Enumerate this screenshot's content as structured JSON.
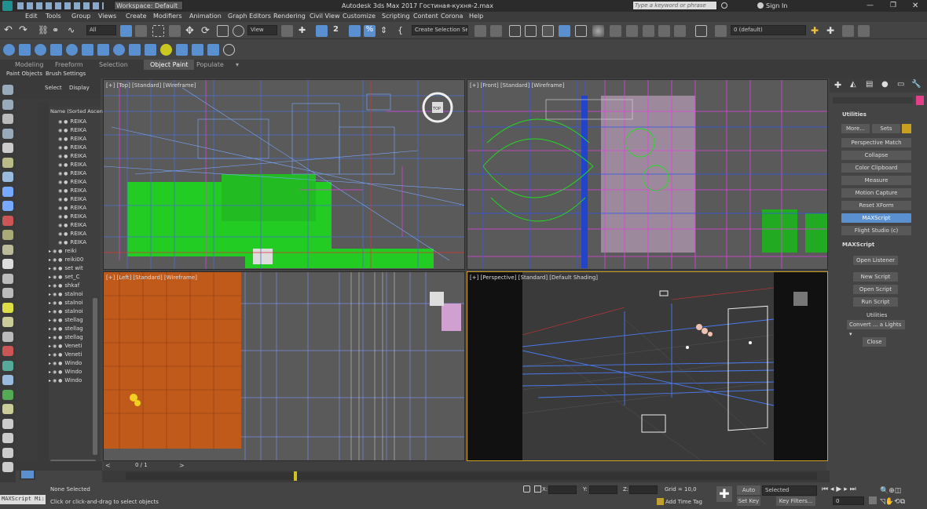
{
  "titlebar": {
    "workspace": "Workspace: Default",
    "title": "Autodesk 3ds Max 2017    Гостиная-кухня-2.max",
    "search_placeholder": "Type a keyword or phrase",
    "sign_in": "Sign In"
  },
  "menu": [
    "Edit",
    "Tools",
    "Group",
    "Views",
    "Create",
    "Modifiers",
    "Animation",
    "Graph Editors",
    "Rendering",
    "Civil View",
    "Customize",
    "Scripting",
    "Content",
    "Corona",
    "Help"
  ],
  "toolbar": {
    "filter_selected": "All",
    "ref_coord": "View",
    "selection_set": "Create Selection Se",
    "layer": "0 (default)"
  },
  "ribbon": {
    "tabs": [
      "Modeling",
      "Freeform",
      "Selection",
      "Object Paint",
      "Populate"
    ],
    "active_tab": "Object Paint",
    "subtabs": [
      "Paint Objects",
      "Brush Settings"
    ]
  },
  "scene_explorer": {
    "tabs": [
      "Select",
      "Display"
    ],
    "column_header": "Name (Sorted Ascen",
    "items": [
      "REIKA",
      "REIKA",
      "REIKA",
      "REIKA",
      "REIKA",
      "REIKA",
      "REIKA",
      "REIKA",
      "REIKA",
      "REIKA",
      "REIKA",
      "REIKA",
      "REIKA",
      "REIKA",
      "REIKA",
      "reiki",
      "reiki00",
      "set wit",
      "set_C",
      "shkaf",
      "stalnoi",
      "stalnoi",
      "stalnoi",
      "stellag",
      "stellag",
      "stellag",
      "Veneti",
      "Veneti",
      "Windo",
      "Windo",
      "Windo"
    ]
  },
  "viewports": {
    "top": "[+] [Top] [Standard] [Wireframe]",
    "front": "[+] [Front] [Standard] [Wireframe]",
    "left": "[+] [Left] [Standard] [Wireframe]",
    "perspective": "[+] [Perspective] [Standard] [Default Shading]",
    "viewcube_label": "TOP"
  },
  "command_panel": {
    "section_utilities": "Utilities",
    "more": "More...",
    "sets": "Sets",
    "utilities": [
      "Perspective Match",
      "Collapse",
      "Color Clipboard",
      "Measure",
      "Motion Capture",
      "Reset XForm",
      "MAXScript",
      "Flight Studio (c)"
    ],
    "active_utility": "MAXScript",
    "section_maxscript": "MAXScript",
    "maxscript_buttons": [
      "Open Listener",
      "New Script",
      "Open Script",
      "Run Script"
    ],
    "utilities_label": "Utilities",
    "utilities_dropdown": "Convert ... a Lights",
    "close": "Close"
  },
  "timeline": {
    "frame": "0 / 1"
  },
  "status": {
    "maxscript_mini": "MAXScript Mi:",
    "none_selected": "None Selected",
    "prompt": "Click or click-and-drag to select objects",
    "x_label": "X:",
    "y_label": "Y:",
    "z_label": "Z:",
    "grid": "Grid = 10,0",
    "add_time_tag": "Add Time Tag",
    "auto_key": "Auto Key",
    "set_key": "Set Key",
    "key_filter_dropdown": "Selected",
    "key_filters": "Key Filters...",
    "frame_field": "0"
  },
  "colors": {
    "accent_blue": "#5a8fd0",
    "wire_green": "#22cc22",
    "wire_magenta": "#e040e0",
    "wire_orange": "#c05a1a"
  }
}
